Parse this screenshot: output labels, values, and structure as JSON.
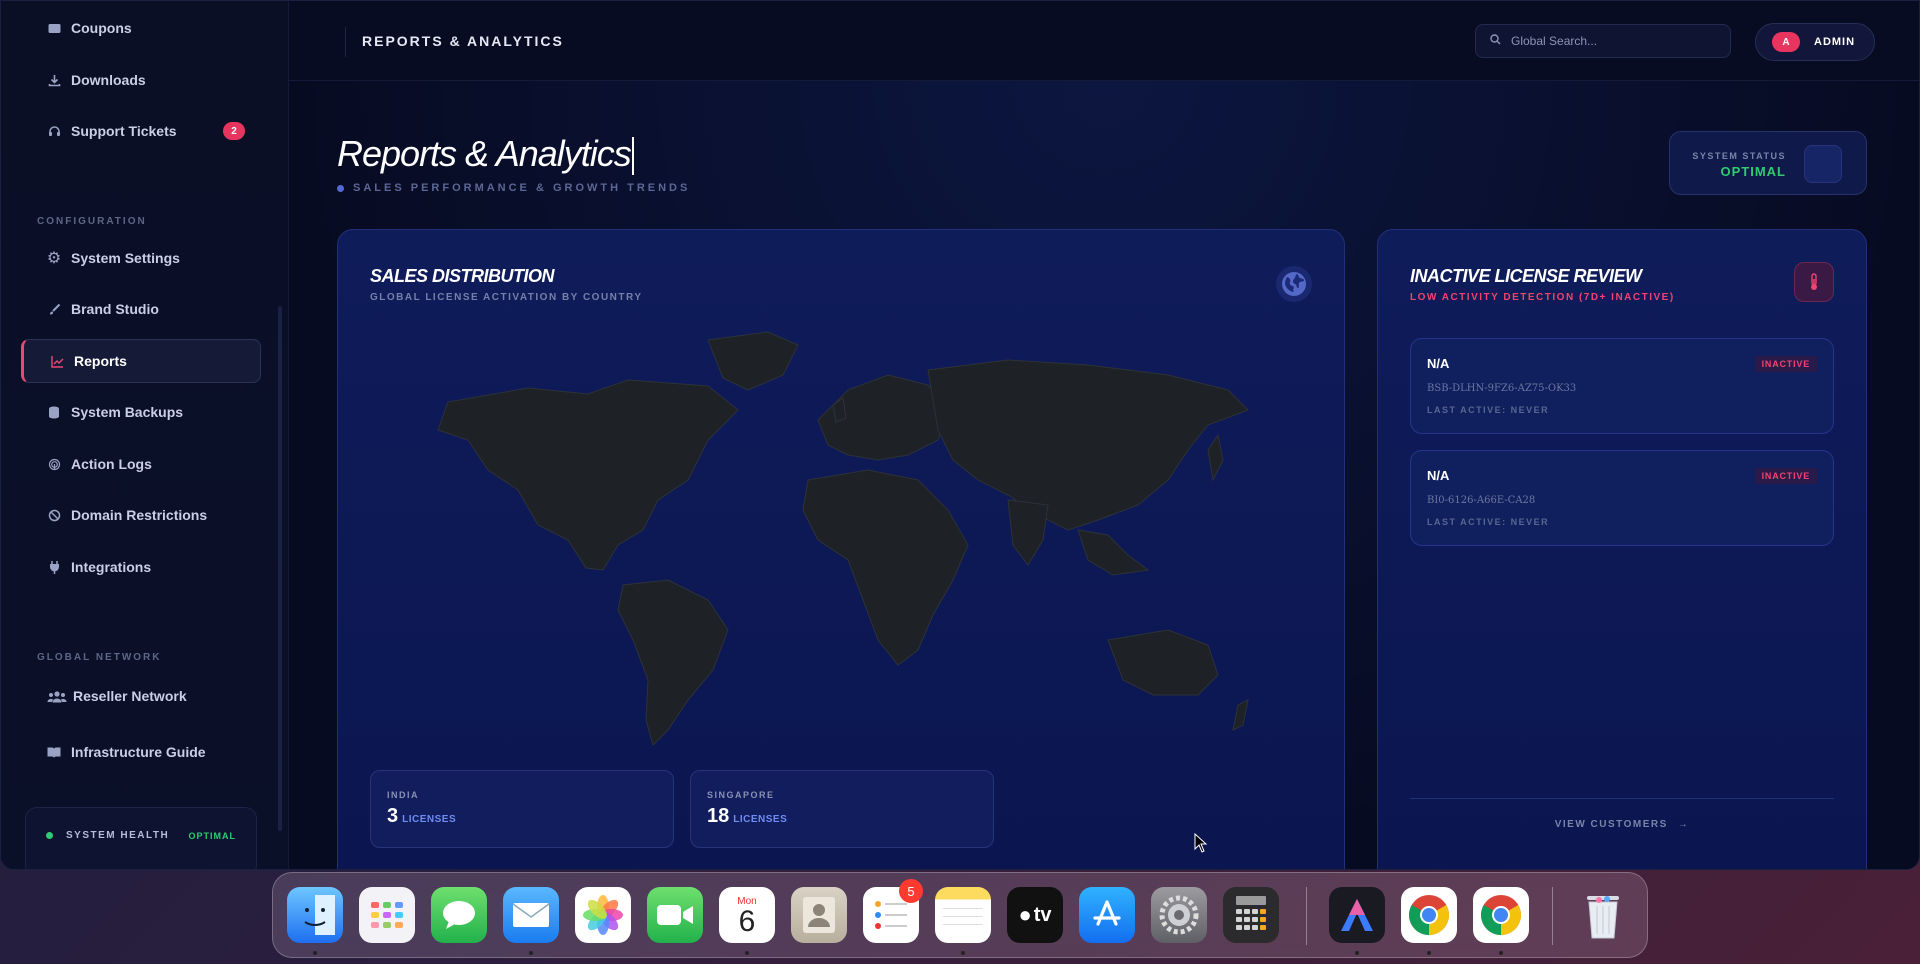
{
  "sidebar": {
    "items_top": [
      {
        "label": "Coupons",
        "icon": "ticket-icon"
      },
      {
        "label": "Downloads",
        "icon": "download-icon"
      },
      {
        "label": "Support Tickets",
        "icon": "headset-icon",
        "badge": "2"
      }
    ],
    "config_title": "CONFIGURATION",
    "config_items": [
      {
        "label": "System Settings",
        "icon": "gear-icon"
      },
      {
        "label": "Brand Studio",
        "icon": "brush-icon"
      },
      {
        "label": "Reports",
        "icon": "chart-line-icon",
        "active": true
      },
      {
        "label": "System Backups",
        "icon": "database-icon"
      },
      {
        "label": "Action Logs",
        "icon": "fingerprint-icon"
      },
      {
        "label": "Domain Restrictions",
        "icon": "ban-icon"
      },
      {
        "label": "Integrations",
        "icon": "plug-icon"
      }
    ],
    "network_title": "GLOBAL NETWORK",
    "network_items": [
      {
        "label": "Reseller Network",
        "icon": "users-icon"
      },
      {
        "label": "Infrastructure Guide",
        "icon": "book-icon"
      }
    ],
    "health": {
      "label": "SYSTEM HEALTH",
      "value": "OPTIMAL"
    }
  },
  "header": {
    "title": "REPORTS & ANALYTICS",
    "search_placeholder": "Global Search...",
    "user_initial": "A",
    "user_label": "ADMIN"
  },
  "page": {
    "title": "Reports & Analytics",
    "subtitle": "SALES PERFORMANCE & GROWTH TRENDS",
    "status_label": "SYSTEM STATUS",
    "status_value": "OPTIMAL"
  },
  "sales": {
    "title": "SALES DISTRIBUTION",
    "subtitle": "GLOBAL LICENSE ACTIVATION BY COUNTRY",
    "stats": [
      {
        "country": "INDIA",
        "count": "3",
        "unit": "LICENSES"
      },
      {
        "country": "SINGAPORE",
        "count": "18",
        "unit": "LICENSES"
      }
    ]
  },
  "inactive": {
    "title": "INACTIVE LICENSE REVIEW",
    "subtitle": "LOW ACTIVITY DETECTION (7D+ INACTIVE)",
    "licenses": [
      {
        "name": "N/A",
        "status": "INACTIVE",
        "key": "BSB-DLHN-9FZ6-AZ75-OK33",
        "last_active": "LAST ACTIVE: NEVER"
      },
      {
        "name": "N/A",
        "status": "INACTIVE",
        "key": "BI0-6126-A66E-CA28",
        "last_active": "LAST ACTIVE: NEVER"
      }
    ],
    "view_link": "VIEW CUSTOMERS"
  },
  "dock": {
    "calendar_month": "Mon",
    "calendar_day": "6",
    "reminders_badge": "5",
    "tv_label": "tv",
    "apps": [
      "Finder",
      "Launchpad",
      "Messages",
      "Mail",
      "Photos",
      "FaceTime",
      "Calendar",
      "Contacts",
      "Reminders",
      "Notes",
      "TV",
      "App Store",
      "System Settings",
      "Calculator",
      "Affinity",
      "Chrome",
      "Chrome",
      "Trash"
    ]
  },
  "colors": {
    "accent": "#e8355f",
    "ok": "#2ecc71",
    "link": "#6f8cf0"
  }
}
